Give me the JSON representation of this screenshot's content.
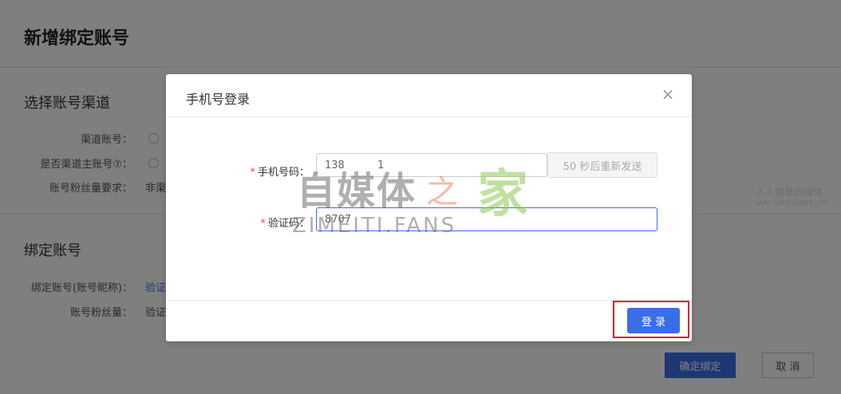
{
  "page": {
    "title": "新增绑定账号",
    "section_channel": {
      "title": "选择账号渠道",
      "channel_label": "渠道账号：",
      "is_main_label": "是否渠道主账号⑦：",
      "fans_req_label": "账号粉丝量要求：",
      "fans_req_value": "非渠"
    },
    "section_bind": {
      "title": "绑定账号",
      "bind_label": "绑定账号(账号昵称)：",
      "bind_value": "验证",
      "fans_label": "账号粉丝量：",
      "fans_value": "验证"
    },
    "confirm_label": "确定绑定",
    "cancel_label": "取 消"
  },
  "modal": {
    "title": "手机号登录",
    "close_symbol": "×",
    "phone_label": "手机号码：",
    "phone_value": "138          1",
    "resend_label": "50 秒后重新发送",
    "code_label": "验证码：",
    "code_value": "8707",
    "required_mark": "*",
    "login_label": "登 录"
  },
  "watermark": {
    "main": "自媒体",
    "zhi": "之",
    "jia": "家",
    "fans": "ZIMEITI.FANS",
    "side_line1": "人人都是自媒体",
    "side_line2": "www.woshizmt.cn"
  },
  "colors": {
    "accent": "#3a6ee8",
    "highlight": "#e02020",
    "required": "#e34d4d"
  }
}
